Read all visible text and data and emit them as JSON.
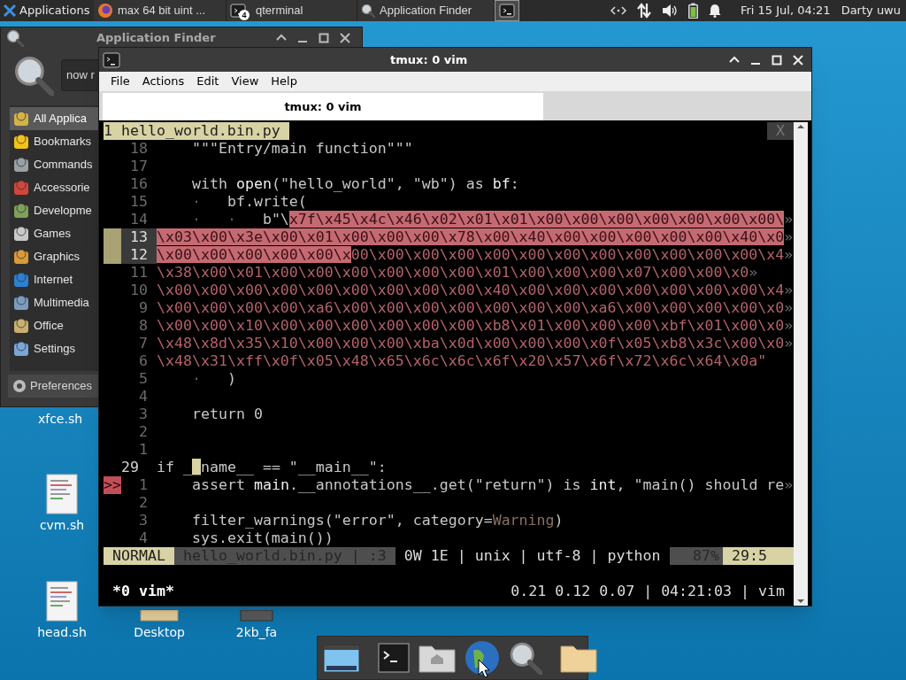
{
  "top_panel": {
    "applications_menu": "Applications",
    "tasks": [
      {
        "kind": "browser",
        "label": "max 64 bit uint ...",
        "selected": false
      },
      {
        "kind": "terminal",
        "label": "qterminal",
        "badge": "4",
        "selected": false
      },
      {
        "kind": "search",
        "label": "Application Finder",
        "selected": false
      },
      {
        "kind": "terminal",
        "selected": true
      }
    ],
    "clock": "Fri 15 Jul, 04:21",
    "user": "Darty uwu"
  },
  "desktop_icons": [
    {
      "label": "xfce.sh"
    },
    {
      "label": "cvm.sh",
      "kind": "script"
    },
    {
      "label": "head.sh",
      "kind": "script"
    },
    {
      "label": "Desktop",
      "kind": "folder"
    },
    {
      "label": "2kb_fa",
      "kind": "file"
    }
  ],
  "application_finder": {
    "title": "Application Finder",
    "search_value": "now r",
    "categories": [
      {
        "label": "All Applica",
        "selected": true
      },
      {
        "label": "Bookmarks",
        "selected": false
      },
      {
        "label": "Commands",
        "selected": false
      },
      {
        "label": "Accessorie",
        "selected": false
      },
      {
        "label": "Developme",
        "selected": false
      },
      {
        "label": "Games",
        "selected": false
      },
      {
        "label": "Graphics",
        "selected": false
      },
      {
        "label": "Internet",
        "selected": false
      },
      {
        "label": "Multimedia",
        "selected": false
      },
      {
        "label": "Office",
        "selected": false
      },
      {
        "label": "Settings",
        "selected": false
      }
    ],
    "button": "Preferences"
  },
  "terminal_window": {
    "title": "tmux: 0 vim",
    "menu": [
      "File",
      "Actions",
      "Edit",
      "View",
      "Help"
    ],
    "tabs": [
      {
        "label": "tmux: 0 vim",
        "selected": true
      }
    ],
    "vim": {
      "tabline": {
        "label": "1 hello_world.bin.py",
        "close": "X"
      },
      "lines": [
        {
          "number": "18",
          "segments": [
            {
              "text": "    \"\"\"Entry/main function\"\"\"",
              "kind": "code"
            }
          ]
        },
        {
          "number": "17"
        },
        {
          "number": "16",
          "segments": [
            {
              "text": "    with ",
              "kind": "code"
            },
            {
              "text": "open",
              "kind": "name"
            },
            {
              "text": "(\"hello_world\", \"wb\") as ",
              "kind": "code"
            },
            {
              "text": "bf",
              "kind": "name"
            },
            {
              "text": ":",
              "kind": "code"
            }
          ]
        },
        {
          "number": "15",
          "segments": [
            {
              "text": "    ·",
              "kind": "listchar"
            },
            {
              "text": "   bf.write(",
              "kind": "code"
            }
          ]
        },
        {
          "number": "14",
          "segments": [
            {
              "text": "    ·",
              "kind": "listchar"
            },
            {
              "text": "   ·",
              "kind": "listchar"
            },
            {
              "text": "   b\"\\",
              "kind": "code"
            },
            {
              "text": "x7f\\x45\\x4c\\x46\\x02\\x01\\x01\\x00\\x00\\x00\\x00\\x00\\x00\\x00\\",
              "kind": "visual"
            },
            {
              "text": "»",
              "kind": "marker"
            }
          ]
        },
        {
          "number": "13",
          "marked": true,
          "segments": [
            {
              "text": "\\x03\\x00\\x3e\\x00\\x01\\x00\\x00\\x00\\x78\\x00\\x40\\x00\\x00\\x00\\x00\\x00\\x40\\x0",
              "kind": "visual"
            },
            {
              "text": "»",
              "kind": "marker"
            }
          ]
        },
        {
          "number": "12",
          "marked": true,
          "segments": [
            {
              "text": "\\x00\\x00\\x00\\x00\\x00\\x",
              "kind": "visual"
            },
            {
              "text": "00\\x00\\x00\\x00\\x00\\x00\\x00\\x00\\x00\\x00\\x00\\x00\\x4",
              "kind": "bytes"
            },
            {
              "text": "»",
              "kind": "marker"
            }
          ]
        },
        {
          "number": "11",
          "segments": [
            {
              "text": "\\x38\\x00\\x01\\x00\\x00\\x00\\x00\\x00\\x00\\x01\\x00\\x00\\x00\\x07\\x00\\x00\\x0",
              "kind": "bytes"
            },
            {
              "text": "»",
              "kind": "marker"
            }
          ]
        },
        {
          "number": "10",
          "segments": [
            {
              "text": "\\x00\\x00\\x00\\x00\\x00\\x00\\x00\\x00\\x00\\x40\\x00\\x00\\x00\\x00\\x00\\x00\\x00\\x4",
              "kind": "bytes"
            },
            {
              "text": "»",
              "kind": "marker"
            }
          ]
        },
        {
          "number": "9",
          "segments": [
            {
              "text": "\\x00\\x00\\x00\\x00\\xa6\\x00\\x00\\x00\\x00\\x00\\x00\\x00\\xa6\\x00\\x00\\x00\\x00\\x0",
              "kind": "bytes"
            },
            {
              "text": "»",
              "kind": "marker"
            }
          ]
        },
        {
          "number": "8",
          "segments": [
            {
              "text": "\\x00\\x00\\x10\\x00\\x00\\x00\\x00\\x00\\x00\\xb8\\x01\\x00\\x00\\x00\\xbf\\x01\\x00\\x0",
              "kind": "bytes"
            },
            {
              "text": "»",
              "kind": "marker"
            }
          ]
        },
        {
          "number": "7",
          "segments": [
            {
              "text": "\\x48\\x8d\\x35\\x10\\x00\\x00\\x00\\xba\\x0d\\x00\\x00\\x00\\x0f\\x05\\xb8\\x3c\\x00\\x0",
              "kind": "bytes"
            },
            {
              "text": "»",
              "kind": "marker"
            }
          ]
        },
        {
          "number": "6",
          "segments": [
            {
              "text": "\\x48\\x31\\xff\\x0f\\x05\\x48\\x65\\x6c\\x6c\\x6f\\x20\\x57\\x6f\\x72\\x6c\\x64\\x0a\"",
              "kind": "bytes"
            }
          ]
        },
        {
          "number": "5",
          "segments": [
            {
              "text": "    ·",
              "kind": "listchar"
            },
            {
              "text": "   )",
              "kind": "code"
            }
          ]
        },
        {
          "number": "4"
        },
        {
          "number": "3",
          "segments": [
            {
              "text": "    return 0",
              "kind": "code"
            }
          ]
        },
        {
          "number": "2"
        },
        {
          "number": "1"
        },
        {
          "number": "29",
          "current": true,
          "segments": [
            {
              "text": "if _",
              "kind": "code"
            },
            {
              "text": "_",
              "kind": "cursor"
            },
            {
              "text": "name__ == \"__main__\":",
              "kind": "code"
            }
          ]
        },
        {
          "number": "1",
          "sign": ">>",
          "segments": [
            {
              "text": "    assert ",
              "kind": "code"
            },
            {
              "text": "main",
              "kind": "name"
            },
            {
              "text": ".__annotations__.get(\"return\") is ",
              "kind": "code"
            },
            {
              "text": "int",
              "kind": "name"
            },
            {
              "text": ", \"main() should re",
              "kind": "code"
            },
            {
              "text": "»",
              "kind": "marker"
            }
          ]
        },
        {
          "number": "2"
        },
        {
          "number": "3",
          "segments": [
            {
              "text": "    filter_warnings(\"error\", category=",
              "kind": "code"
            },
            {
              "text": "Warning",
              "kind": "type"
            },
            {
              "text": ")",
              "kind": "code"
            }
          ]
        },
        {
          "number": "4",
          "segments": [
            {
              "text": "    sys.exit(main())",
              "kind": "code"
            }
          ]
        }
      ],
      "statusline": [
        {
          "kind": "mode",
          "text": "NORMAL"
        },
        {
          "kind": "file",
          "text": "hello_world.bin.py | :3"
        },
        {
          "kind": "info",
          "text": "0W 1E | unix | utf-8 | python"
        },
        {
          "kind": "percent",
          "text": "87%"
        },
        {
          "kind": "position",
          "text": "29:5"
        }
      ]
    },
    "tmux_status": {
      "left": "*0 vim*",
      "right": "0.21 0.12 0.07 | 04:21:03 | vim"
    }
  }
}
